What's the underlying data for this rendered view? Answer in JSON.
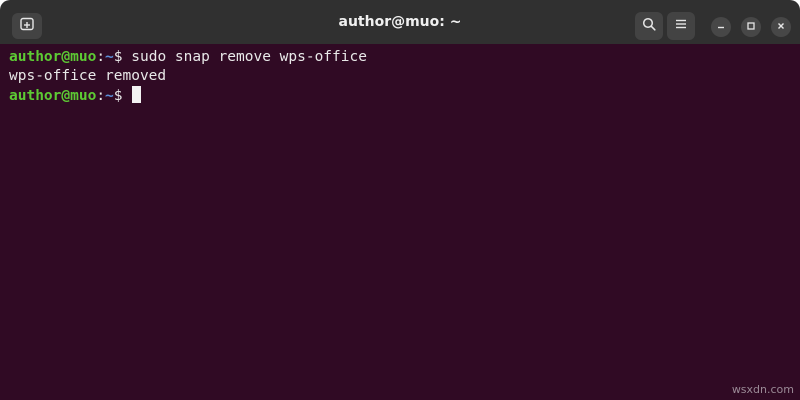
{
  "window": {
    "title": "author@muo: ~"
  },
  "terminal": {
    "lines": [
      {
        "user": "author@muo",
        "sep": ":",
        "path": "~",
        "symbol": "$ ",
        "command": "sudo snap remove wps-office"
      },
      {
        "output": "wps-office removed"
      },
      {
        "user": "author@muo",
        "sep": ":",
        "path": "~",
        "symbol": "$ ",
        "command": ""
      }
    ]
  },
  "icons": {
    "new_tab": "new-tab-icon",
    "search": "search-icon",
    "menu": "hamburger-menu-icon",
    "minimize": "minimize-icon",
    "maximize": "maximize-icon",
    "close": "close-icon"
  },
  "colors": {
    "titlebar": "#303030",
    "terminal_bg": "#300a24",
    "prompt_user": "#5dcb34",
    "prompt_path": "#5b8fd8",
    "text": "#e8e8e8"
  },
  "watermark": "wsxdn.com"
}
